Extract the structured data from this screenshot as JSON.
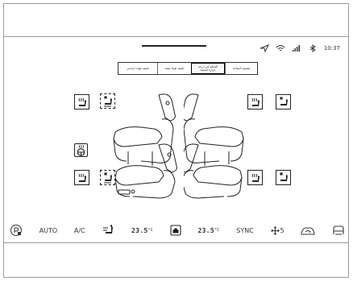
{
  "status": {
    "time": "10:37",
    "icons": [
      "navigation-icon",
      "wifi-icon",
      "signal-icon",
      "bluetooth-icon"
    ]
  },
  "tabs": [
    {
      "label": "تكييف هواء اساسي",
      "selected": false
    },
    {
      "label": "تكييف هواء مقعد",
      "selected": false
    },
    {
      "label": "التحكم في درجة حرارة المقعد",
      "selected": true
    },
    {
      "label": "تشغيل المقاعد",
      "selected": false
    }
  ],
  "bottom_bar": {
    "auto_label": "AUTO",
    "ac_label": "A/C",
    "left_temp": "23.5",
    "left_temp_unit": "°C",
    "right_temp": "23.5",
    "right_temp_unit": "°C",
    "sync_label": "SYNC",
    "fan_level": "5"
  }
}
